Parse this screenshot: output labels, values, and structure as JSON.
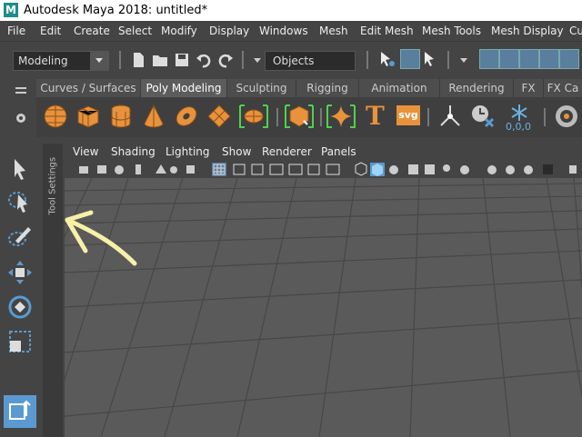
{
  "window": {
    "title": "Autodesk Maya 2018: untitled*",
    "logo_letter": "M"
  },
  "menubar": {
    "items": [
      "File",
      "Edit",
      "Create",
      "Select",
      "Modify",
      "Display",
      "Windows",
      "Mesh",
      "Edit Mesh",
      "Mesh Tools",
      "Mesh Display",
      "Cu"
    ]
  },
  "statusline": {
    "mode": "Modeling",
    "object_field": "Objects"
  },
  "shelf": {
    "tabs": [
      "Curves / Surfaces",
      "Poly Modeling",
      "Sculpting",
      "Rigging",
      "Animation",
      "Rendering",
      "FX",
      "FX Ca"
    ],
    "active_tab": "Poly Modeling",
    "text_icon": "T",
    "svg_icon": "svg",
    "coords_label": "0,0,0"
  },
  "toolsettings": {
    "label": "Tool Settings"
  },
  "viewport": {
    "menu": [
      "View",
      "Shading",
      "Lighting",
      "Show",
      "Renderer",
      "Panels"
    ]
  },
  "colors": {
    "accent_orange": "#e8923c",
    "accent_blue": "#5a9ad0",
    "annotation_yellow": "#f7f0a8"
  }
}
